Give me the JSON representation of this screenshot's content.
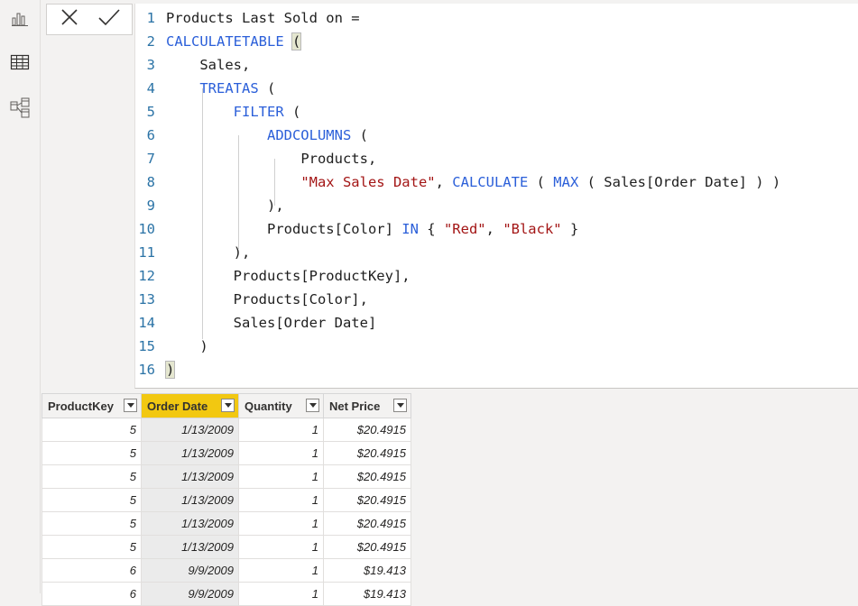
{
  "nav": {
    "items": [
      {
        "id": "report",
        "icon": "report-view-icon",
        "active": false
      },
      {
        "id": "data",
        "icon": "data-view-icon",
        "active": true
      },
      {
        "id": "model",
        "icon": "model-view-icon",
        "active": false
      }
    ]
  },
  "formula_bar": {
    "cancel_icon": "close-icon",
    "commit_icon": "check-icon",
    "line_numbers": [
      "1",
      "2",
      "3",
      "4",
      "5",
      "6",
      "7",
      "8",
      "9",
      "10",
      "11",
      "12",
      "13",
      "14",
      "15",
      "16"
    ],
    "line1": "Products Last Sold on =",
    "line2_kw": "CALCULATETABLE",
    "line2_paren": "(",
    "line3": "Sales,",
    "line4_kw": "TREATAS",
    "line4_rest": " (",
    "line5_kw": "FILTER",
    "line5_rest": " (",
    "line6_kw": "ADDCOLUMNS",
    "line6_rest": " (",
    "line7": "Products,",
    "line8_str": "\"Max Sales Date\"",
    "line8_comma": ", ",
    "line8_kw1": "CALCULATE",
    "line8_p1": " ( ",
    "line8_kw2": "MAX",
    "line8_rest": " ( Sales[Order Date] ) )",
    "line9": "),",
    "line10_a": "Products[Color] ",
    "line10_kw": "IN",
    "line10_b": " { ",
    "line10_s1": "\"Red\"",
    "line10_c": ", ",
    "line10_s2": "\"Black\"",
    "line10_d": " }",
    "line11": "),",
    "line12": "Products[ProductKey],",
    "line13": "Products[Color],",
    "line14": "Sales[Order Date]",
    "line15": ")",
    "line16": ")"
  },
  "table": {
    "columns": [
      "ProductKey",
      "Order Date",
      "Quantity",
      "Net Price"
    ],
    "selected_column": "Order Date",
    "rows": [
      [
        "5",
        "1/13/2009",
        "1",
        "$20.4915"
      ],
      [
        "5",
        "1/13/2009",
        "1",
        "$20.4915"
      ],
      [
        "5",
        "1/13/2009",
        "1",
        "$20.4915"
      ],
      [
        "5",
        "1/13/2009",
        "1",
        "$20.4915"
      ],
      [
        "5",
        "1/13/2009",
        "1",
        "$20.4915"
      ],
      [
        "5",
        "1/13/2009",
        "1",
        "$20.4915"
      ],
      [
        "6",
        "9/9/2009",
        "1",
        "$19.413"
      ],
      [
        "6",
        "9/9/2009",
        "1",
        "$19.413"
      ]
    ]
  },
  "colors": {
    "accent_yellow": "#f2c811",
    "keyword_blue": "#2b5fd9",
    "string_red": "#a31515"
  }
}
